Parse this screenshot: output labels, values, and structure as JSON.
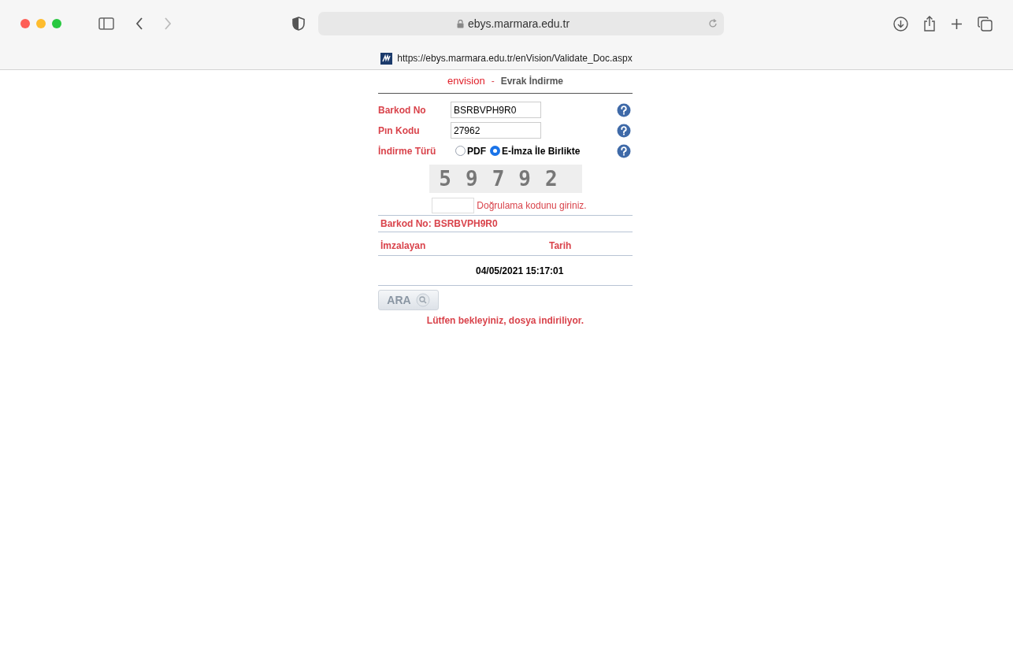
{
  "browser": {
    "address": "ebys.marmara.edu.tr",
    "page_url": "https://ebys.marmara.edu.tr/enVision/Validate_Doc.aspx"
  },
  "header": {
    "logo": "envision",
    "separator": "-",
    "title": "Evrak İndirme"
  },
  "fields": [
    {
      "label": "Barkod No",
      "value": "BSRBVPH9R0"
    },
    {
      "label": "Pın Kodu",
      "value": "27962"
    }
  ],
  "download_type": {
    "label": "İndirme Türü",
    "options": [
      {
        "label": "PDF",
        "selected": false
      },
      {
        "label": "E-İmza İle Birlikte",
        "selected": true
      }
    ]
  },
  "captcha": {
    "text": "59792",
    "prompt": "Doğrulama kodunu giriniz."
  },
  "barcode_line": "Barkod No: BSRBVPH9R0",
  "table": {
    "columns": [
      "İmzalayan",
      "Tarih"
    ],
    "rows": [
      [
        "",
        "04/05/2021 15:17:01"
      ]
    ]
  },
  "search_button": "ARA",
  "status": "Lütfen bekleyiniz, dosya indiriliyor."
}
